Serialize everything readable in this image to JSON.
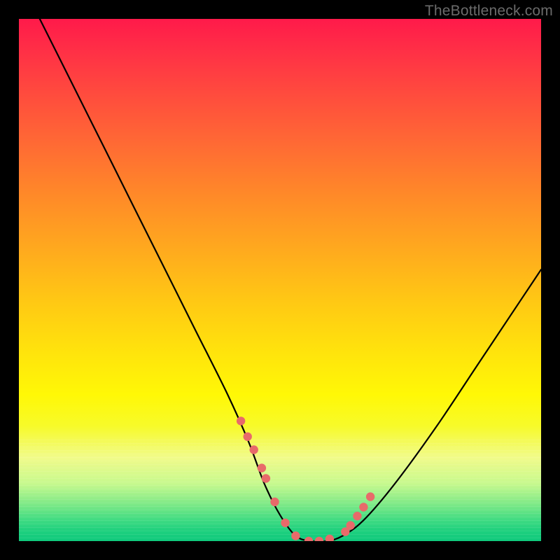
{
  "watermark": "TheBottleneck.com",
  "chart_data": {
    "type": "line",
    "title": "",
    "xlabel": "",
    "ylabel": "",
    "xlim": [
      0,
      100
    ],
    "ylim": [
      0,
      100
    ],
    "grid": false,
    "legend": false,
    "series": [
      {
        "name": "bottleneck-curve",
        "x": [
          4,
          10,
          16,
          22,
          28,
          34,
          40,
          44,
          47,
          50,
          53,
          56,
          59,
          62,
          66,
          72,
          80,
          88,
          96,
          100
        ],
        "y": [
          100,
          88,
          76,
          64,
          52,
          40,
          28,
          19,
          11,
          5,
          1,
          0,
          0,
          1,
          4,
          11,
          22,
          34,
          46,
          52
        ]
      }
    ],
    "markers": {
      "name": "highlight-dots",
      "color": "#e86a6a",
      "points_x": [
        42.5,
        43.8,
        45.0,
        46.5,
        47.3,
        49.0,
        51.0,
        53.0,
        55.5,
        57.5,
        59.5,
        62.5,
        63.5,
        64.8,
        66.0,
        67.3
      ],
      "points_y": [
        23.0,
        20.0,
        17.5,
        14.0,
        12.0,
        7.5,
        3.5,
        1.0,
        0.0,
        0.0,
        0.4,
        1.8,
        3.0,
        4.8,
        6.5,
        8.5
      ]
    },
    "gradient_stops": [
      {
        "pos": 0,
        "color": "#ff1a4a"
      },
      {
        "pos": 34,
        "color": "#ff8a28"
      },
      {
        "pos": 64,
        "color": "#ffe40c"
      },
      {
        "pos": 89,
        "color": "#c7f98e"
      },
      {
        "pos": 100,
        "color": "#0fc97c"
      }
    ]
  }
}
